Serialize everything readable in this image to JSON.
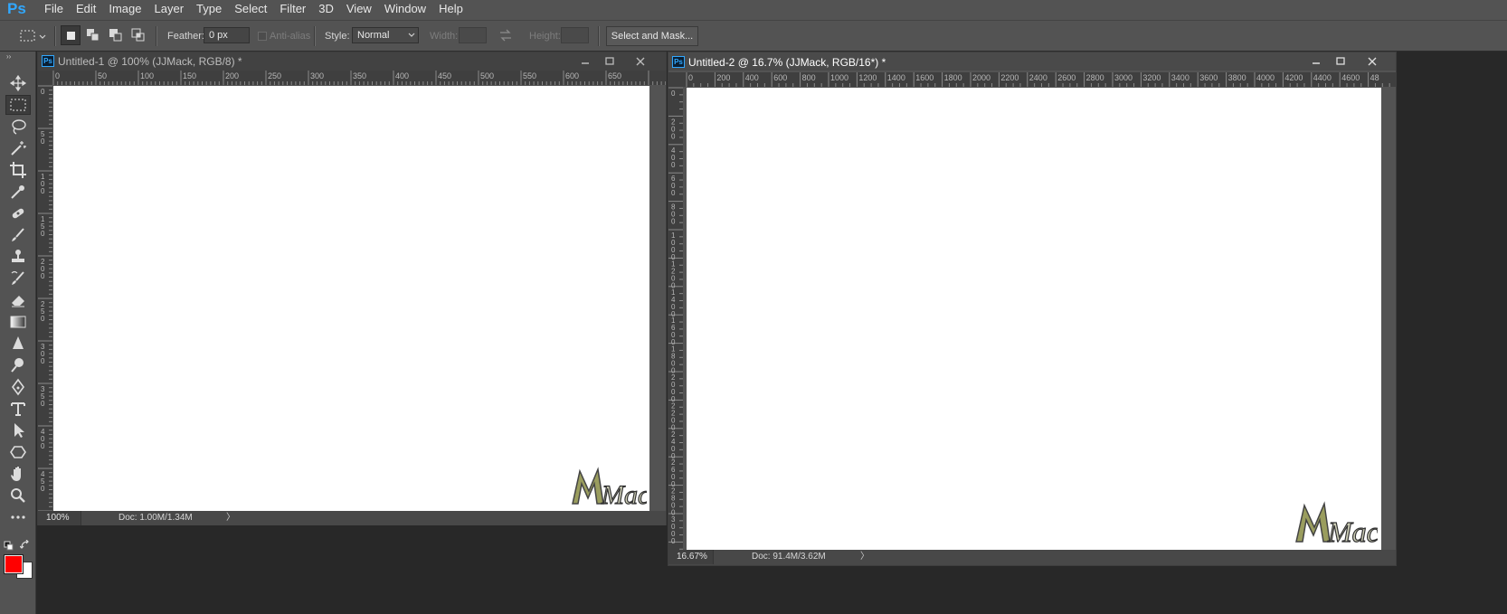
{
  "app": {
    "logo": "Ps",
    "accent": "#31a8ff"
  },
  "menu": [
    "File",
    "Edit",
    "Image",
    "Layer",
    "Type",
    "Select",
    "Filter",
    "3D",
    "View",
    "Window",
    "Help"
  ],
  "options": {
    "feather_label": "Feather:",
    "feather_value": "0 px",
    "antialias_label": "Anti-alias",
    "style_label": "Style:",
    "style_value": "Normal",
    "width_label": "Width:",
    "height_label": "Height:",
    "select_mask_label": "Select and Mask..."
  },
  "tools": [
    "move-tool",
    "rectangular-marquee-tool",
    "lasso-tool",
    "quick-selection-tool",
    "crop-tool",
    "eyedropper-tool",
    "spot-healing-tool",
    "brush-tool",
    "clone-stamp-tool",
    "history-brush-tool",
    "eraser-tool",
    "gradient-tool",
    "blur-tool",
    "dodge-tool",
    "pen-tool",
    "type-tool",
    "path-selection-tool",
    "shape-tool",
    "hand-tool",
    "zoom-tool",
    "more-tools"
  ],
  "colors": {
    "foreground": "#ff0000",
    "background": "#ffffff"
  },
  "doc1": {
    "title": "Untitled-1 @ 100% (JJMack, RGB/8) *",
    "ruler_h": [
      "0",
      "50",
      "100",
      "150",
      "200",
      "250",
      "300",
      "350",
      "400",
      "450",
      "500",
      "550",
      "600",
      "650"
    ],
    "ruler_v": [
      "0",
      "50",
      "100",
      "150",
      "200",
      "250",
      "300",
      "350",
      "400",
      "450"
    ],
    "zoom": "100%",
    "doc_info": "Doc: 1.00M/1.34M",
    "watermark": "Mack"
  },
  "doc2": {
    "title": "Untitled-2 @ 16.7% (JJMack, RGB/16*) *",
    "ruler_h": [
      "0",
      "200",
      "400",
      "600",
      "800",
      "1000",
      "1200",
      "1400",
      "1600",
      "1800",
      "2000",
      "2200",
      "2400",
      "2600",
      "2800",
      "3000",
      "3200",
      "3400",
      "3600",
      "3800",
      "4000",
      "4200",
      "4400",
      "4600",
      "48"
    ],
    "ruler_v": [
      "0",
      "200",
      "400",
      "600",
      "800",
      "1000",
      "1200",
      "1400",
      "1600",
      "1800",
      "2000",
      "2200",
      "2400",
      "2600",
      "2800",
      "3000"
    ],
    "zoom": "16.67%",
    "doc_info": "Doc: 91.4M/3.62M",
    "watermark": "Mack"
  }
}
